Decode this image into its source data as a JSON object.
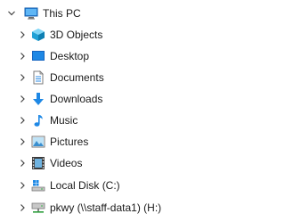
{
  "tree": {
    "root": {
      "label": "This PC",
      "icon": "this-pc-icon",
      "expanded": true
    },
    "items": [
      {
        "label": "3D Objects",
        "icon": "3d-objects-icon"
      },
      {
        "label": "Desktop",
        "icon": "desktop-icon"
      },
      {
        "label": "Documents",
        "icon": "documents-icon"
      },
      {
        "label": "Downloads",
        "icon": "downloads-icon"
      },
      {
        "label": "Music",
        "icon": "music-icon"
      },
      {
        "label": "Pictures",
        "icon": "pictures-icon"
      },
      {
        "label": "Videos",
        "icon": "videos-icon"
      },
      {
        "label": "Local Disk (C:)",
        "icon": "local-disk-icon"
      },
      {
        "label": "pkwy (\\\\staff-data1) (H:)",
        "icon": "network-drive-icon"
      }
    ]
  },
  "colors": {
    "background": "#ffffff",
    "text": "#1a1a1a",
    "chevron": "#444444",
    "accent_blue": "#1e88e5"
  }
}
